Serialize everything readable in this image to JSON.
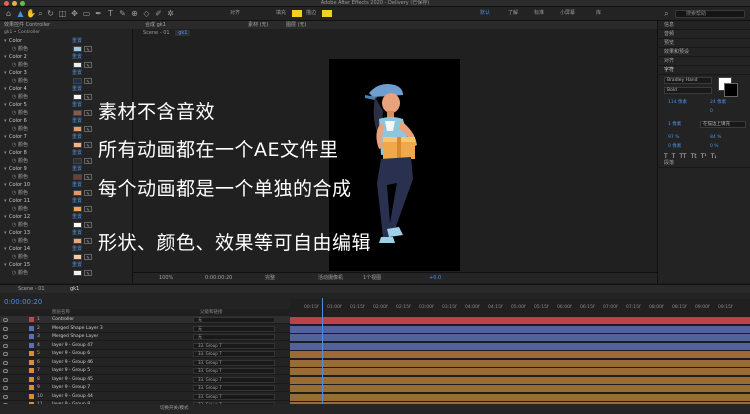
{
  "window": {
    "title": "Adobe After Effects 2020 - Delivery (已保存)"
  },
  "toolbar": {
    "default_label": "默认",
    "learn_label": "了解",
    "standard_label": "标准",
    "small_screen_label": "小屏幕",
    "libraries_label": "库",
    "search_placeholder": "搜索帮助",
    "align_label": "对齐",
    "fill_label": "填充",
    "stroke_label": "描边"
  },
  "effects_panel": {
    "tab": "效果控件 Controller",
    "breadcrumb": "gk1 • Controller",
    "sub_label": "颜色",
    "reset_label": "重置",
    "items": [
      {
        "name": "Color",
        "color": "#9ec9e6"
      },
      {
        "name": "Color 2",
        "color": "#e9eef1"
      },
      {
        "name": "Color 3",
        "color": "#1e2d52"
      },
      {
        "name": "Color 4",
        "color": "#f4f4f4"
      },
      {
        "name": "Color 5",
        "color": "#8b5b4a"
      },
      {
        "name": "Color 6",
        "color": "#e89a6a"
      },
      {
        "name": "Color 7",
        "color": "#f2b48a"
      },
      {
        "name": "Color 8",
        "color": "#2b2f3a"
      },
      {
        "name": "Color 9",
        "color": "#6b4038"
      },
      {
        "name": "Color 10",
        "color": "#ea9666"
      },
      {
        "name": "Color 11",
        "color": "#f5a34b"
      },
      {
        "name": "Color 12",
        "color": "#fcfcfc"
      },
      {
        "name": "Color 13",
        "color": "#e8a77e"
      },
      {
        "name": "Color 14",
        "color": "#f7c9a6"
      },
      {
        "name": "Color 15",
        "color": "#f0f0f0"
      }
    ]
  },
  "viewer": {
    "tab_comp": "合成 gk1",
    "tab_material": "素材 (无)",
    "tab_layer": "图层 (无)",
    "scene_label": "Scene - 01",
    "scene_tab": "gk1",
    "captions": [
      "素材不含音效",
      "所有动画都在一个AE文件里",
      "每个动画都是一个单独的合成",
      "形状、颜色、效果等可自由编辑"
    ],
    "footer": {
      "zoom": "100%",
      "timecode": "0:00:00:20",
      "quality": "完整",
      "camera": "活动摄像机",
      "views": "1个视图",
      "offset": "+0.0"
    }
  },
  "right_panel": {
    "sections": [
      "信息",
      "音频",
      "预览",
      "效果和预设",
      "对齐",
      "字符",
      "段落"
    ],
    "font_name": "Bradley Hand",
    "font_style": "Bold",
    "size_value": "114 像素",
    "leading_value": "24 像素",
    "kerning": "0",
    "stroke_label": "在描边上填充",
    "stroke_value": "1 像素",
    "vscale": "97 %",
    "hscale": "84 %",
    "baseline": "0 像素",
    "tsume": "0 %"
  },
  "timeline": {
    "tab": "Scene - 01",
    "tab2": "gk1",
    "timecode": "0:00:00:20",
    "col_name": "图层名称",
    "col_parent": "父级和链接",
    "mode_label": "切换开关/模式",
    "ruler_ticks": [
      "00:15f",
      "01:00f",
      "01:15f",
      "02:00f",
      "02:15f",
      "03:00f",
      "03:15f",
      "04:00f",
      "04:15f",
      "05:00f",
      "05:15f",
      "06:00f",
      "06:15f",
      "07:00f",
      "07:15f",
      "08:00f",
      "08:15f",
      "09:00f",
      "09:15f"
    ],
    "layers": [
      {
        "num": "1",
        "name": "Controller",
        "label": "#c5434e",
        "bar": "#c5434e",
        "parent": "无"
      },
      {
        "num": "2",
        "name": "Merged Shape Layer 3",
        "label": "#5a6fb3",
        "bar": "#5a6fb3",
        "parent": "无"
      },
      {
        "num": "3",
        "name": "Merged Shape Layer",
        "label": "#5a6fb3",
        "bar": "#5a6fb3",
        "parent": "无"
      },
      {
        "num": "4",
        "name": "layer 9 - Group 47",
        "label": "#5a6fb3",
        "bar": "#5a6fb3",
        "parent": "33. Group 7"
      },
      {
        "num": "5",
        "name": "layer 9 - Group 6",
        "label": "#d38f35",
        "bar": "#b07a3a",
        "parent": "33. Group 7"
      },
      {
        "num": "6",
        "name": "layer 9 - Group 46",
        "label": "#d38f35",
        "bar": "#b07a3a",
        "parent": "33. Group 7"
      },
      {
        "num": "7",
        "name": "layer 9 - Group 5",
        "label": "#d38f35",
        "bar": "#b07a3a",
        "parent": "33. Group 7"
      },
      {
        "num": "8",
        "name": "layer 9 - Group 45",
        "label": "#d38f35",
        "bar": "#b07a3a",
        "parent": "33. Group 7"
      },
      {
        "num": "9",
        "name": "layer 9 - Group 7",
        "label": "#d38f35",
        "bar": "#b07a3a",
        "parent": "33. Group 7"
      },
      {
        "num": "10",
        "name": "layer 9 - Group 44",
        "label": "#d38f35",
        "bar": "#b07a3a",
        "parent": "33. Group 7"
      },
      {
        "num": "11",
        "name": "layer 9 - Group 8",
        "label": "#d38f35",
        "bar": "#b07a3a",
        "parent": "33. Group 7"
      }
    ]
  },
  "colors": {
    "accent": "#4b8fe0",
    "panel": "#232323",
    "bg": "#1c1c1c",
    "canvas": "#000000"
  }
}
